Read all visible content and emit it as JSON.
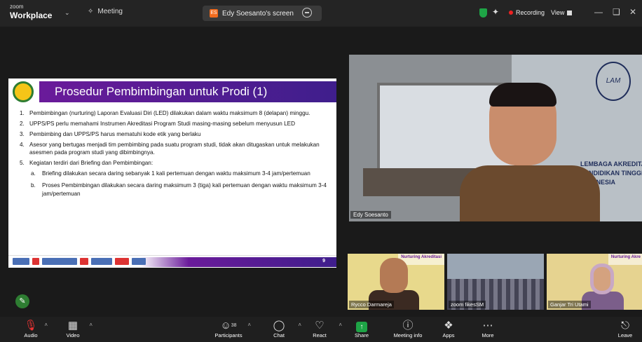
{
  "titlebar": {
    "brand_small": "zoom",
    "brand": "Workplace",
    "meeting_tab": "Meeting",
    "share_badge": "ES",
    "share_tab": "Edy Soesanto's screen",
    "recording": "Recording",
    "view": "View"
  },
  "slide": {
    "title": "Prosedur Pembimbingan untuk Prodi (1)",
    "page": "9",
    "items": [
      {
        "n": "1.",
        "text": "Pembimbingan (nurturing) Laporan Evaluasi Diri (LED) dilakukan dalam waktu maksimum 8 (delapan) minggu."
      },
      {
        "n": "2.",
        "text": "UPPS/PS perlu memahami Instrumen Akreditasi Program Studi masing-masing sebelum menyusun LED"
      },
      {
        "n": "3.",
        "text": "Pembimbing dan UPPS/PS harus mematuhi kode etik yang berlaku"
      },
      {
        "n": "4.",
        "text": "Asesor yang bertugas menjadi tim pembimbing pada suatu program studi, tidak akan ditugaskan untuk melakukan asesmen pada program studi yang dibimbingnya."
      },
      {
        "n": "5.",
        "text": "Kegiatan terdiri dari Briefing dan Pembimbingan:"
      }
    ],
    "subitems": [
      {
        "n": "a.",
        "text": "Briefing dilakukan secara daring sebanyak 1 kali pertemuan dengan waktu maksimum 3-4 jam/pertemuan"
      },
      {
        "n": "b.",
        "text": "Proses Pembimbingan dilakukan secara daring maksimum 3 (tiga) kali pertemuan dengan waktu maksimum 3-4 jam/pertemuan"
      }
    ]
  },
  "main_video": {
    "name": "Edy Soesanto",
    "wall_text_1": "LEMBAGA AKREDITASI MANDIRI",
    "wall_text_2": "PENDIDIKAN TINGGI KESEHATAN",
    "wall_text_3": "INDONESIA",
    "logo": "LAM"
  },
  "thumbnails": [
    {
      "name": "Rycco Darmareja",
      "banner": "Nurturing Akreditasi"
    },
    {
      "name": "zoom fikesSM",
      "banner": ""
    },
    {
      "name": "Ganjar Tri Utami",
      "banner": "Nurturing Akre"
    }
  ],
  "toolbar": {
    "audio": "Audio",
    "video": "Video",
    "participants_count": "38",
    "participants": "Participants",
    "chat": "Chat",
    "react": "React",
    "share": "Share",
    "meeting_info": "Meeting info",
    "apps": "Apps",
    "more": "More",
    "leave": "Leave"
  }
}
